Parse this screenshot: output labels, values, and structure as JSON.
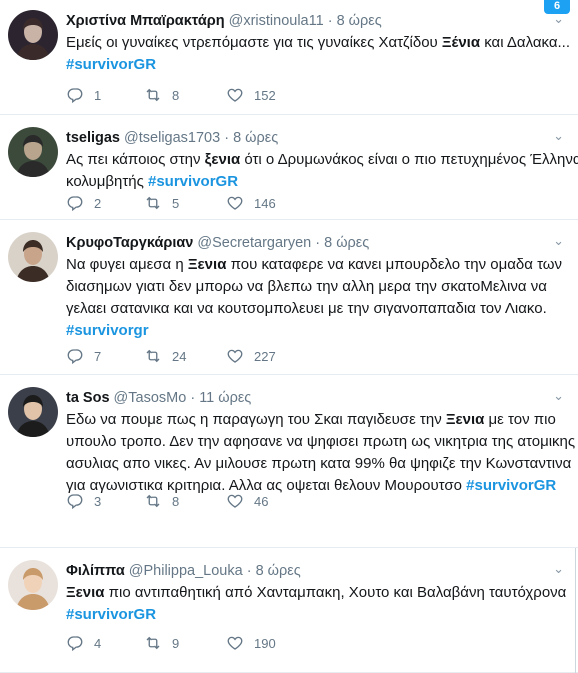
{
  "corner_badge": "6",
  "tweets": [
    {
      "name": "Χριστίνα Μπαϊρακτάρη",
      "handle": "@xristinoula11",
      "time": "8 ώρες",
      "lines": [
        [
          {
            "t": "Εμείς οι γυναίκες ντρεπόμαστε για τις γυναίκες Χατζίδου "
          },
          {
            "t": "Ξένια",
            "b": true
          },
          {
            "t": " και Δαλακα..."
          }
        ],
        [
          {
            "t": "#survivorGR",
            "tag": true
          }
        ]
      ],
      "replies": "1",
      "retweets": "8",
      "likes": "152"
    },
    {
      "name": "tseligas",
      "handle": "@tseligas1703",
      "time": "8 ώρες",
      "lines": [
        [
          {
            "t": "Ας πει κάποιος στην "
          },
          {
            "t": "ξενια",
            "b": true
          },
          {
            "t": " ότι ο Δρυμωνάκος είναι ο πιο πετυχημένος Έλληνας"
          }
        ],
        [
          {
            "t": "κολυμβητής  "
          },
          {
            "t": "#survivorGR",
            "tag": true
          }
        ]
      ],
      "replies": "2",
      "retweets": "5",
      "likes": "146"
    },
    {
      "name": "ΚρυφοΤαργκάριαν",
      "handle": "@Secretargaryen",
      "time": "8 ώρες",
      "lines": [
        [
          {
            "t": "Να φυγει αμεσα η "
          },
          {
            "t": "Ξενια",
            "b": true
          },
          {
            "t": " που καταφερε να κανει μπουρδελο την ομαδα των"
          }
        ],
        [
          {
            "t": "διασημων γιατι δεν μπορω να βλεπω την αλλη μερα την σκατοΜελινα να"
          }
        ],
        [
          {
            "t": "γελαει σατανικα και να κουτσομπολευει με την σιγανοπαπαδια τον Λιακο."
          }
        ],
        [
          {
            "t": "#survivorgr",
            "tag": true
          }
        ]
      ],
      "replies": "7",
      "retweets": "24",
      "likes": "227"
    },
    {
      "name": "ta Sos",
      "handle": "@TasosMo",
      "time": "11 ώρες",
      "lines": [
        [
          {
            "t": "Εδω να πουμε πως η παραγωγη του Σκαι παγιδευσε την "
          },
          {
            "t": "Ξενια",
            "b": true
          },
          {
            "t": " με τον πιο"
          }
        ],
        [
          {
            "t": "υπουλο τροπο. Δεν την αφησανε να ψηφισει πρωτη ως νικητρια της ατομικης"
          }
        ],
        [
          {
            "t": "ασυλιας απο νικες. Αν μιλουσε πρωτη κατα 99% θα ψηφιζε την Κωνσταντινα"
          }
        ],
        [
          {
            "t": "για αγωνιστικα κριτηρια. Αλλα ας οψεται θελουν Μουρουτσο  "
          },
          {
            "t": "#survivorGR",
            "tag": true
          }
        ]
      ],
      "replies": "3",
      "retweets": "8",
      "likes": "46"
    },
    {
      "name": "Φιλίππα",
      "handle": "@Philippa_Louka",
      "time": "8 ώρες",
      "lines": [
        [
          {
            "t": "Ξενια",
            "b": true
          },
          {
            "t": " πιο αντιπαθητική από Χανταμπακη, Χουτο και Βαλαβάνη ταυτόχρονα"
          }
        ],
        [
          {
            "t": "#survivorGR",
            "tag": true
          }
        ]
      ],
      "replies": "4",
      "retweets": "9",
      "likes": "190"
    }
  ]
}
